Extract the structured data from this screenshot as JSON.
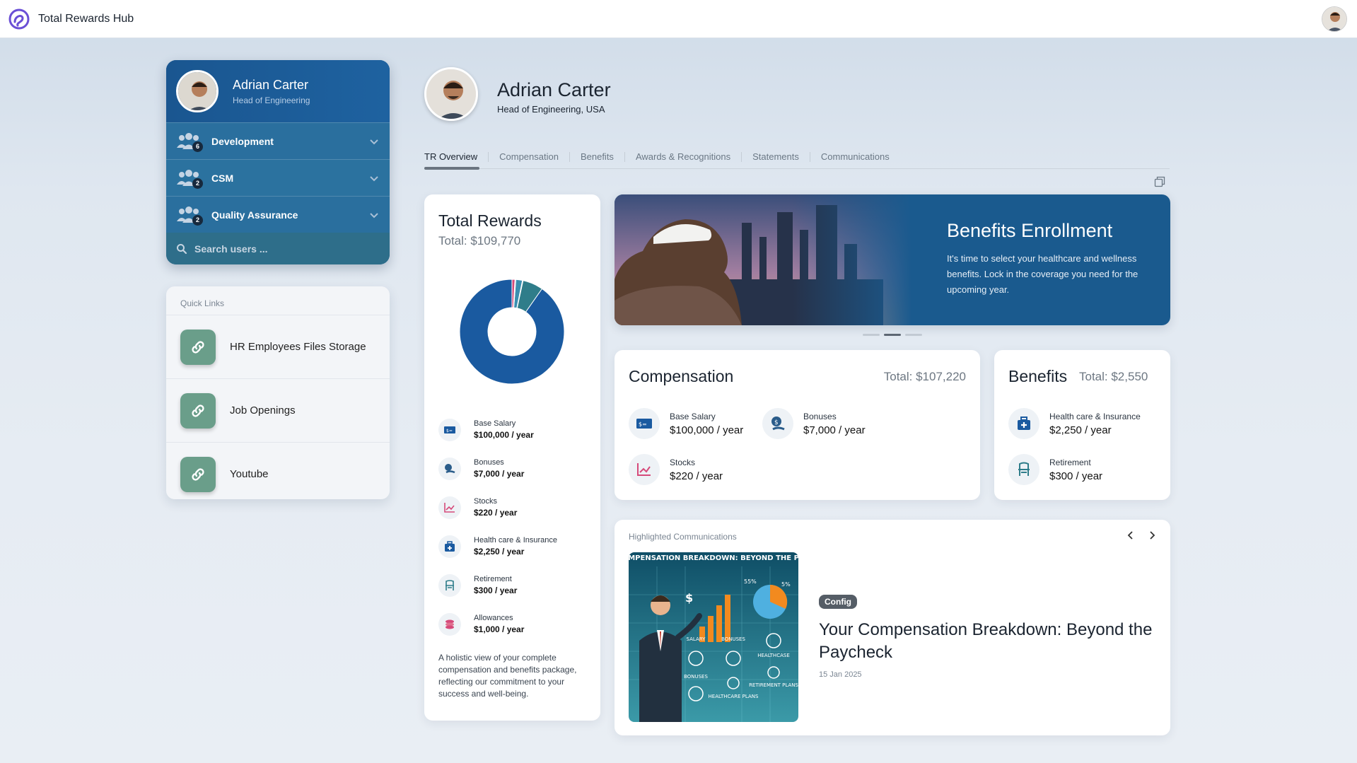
{
  "app": {
    "title": "Total Rewards Hub"
  },
  "sidebar": {
    "user": {
      "name": "Adrian Carter",
      "role": "Head of Engineering"
    },
    "groups": [
      {
        "label": "Development",
        "count": "6"
      },
      {
        "label": "CSM",
        "count": "2"
      },
      {
        "label": "Quality Assurance",
        "count": "2"
      }
    ],
    "search": {
      "placeholder": "Search users ..."
    }
  },
  "quick_links": {
    "title": "Quick Links",
    "items": [
      {
        "label": "HR Employees Files Storage"
      },
      {
        "label": "Job Openings"
      },
      {
        "label": "Youtube"
      }
    ]
  },
  "profile": {
    "name": "Adrian Carter",
    "role": "Head of Engineering, USA"
  },
  "tabs": [
    "TR Overview",
    "Compensation",
    "Benefits",
    "Awards & Recognitions",
    "Statements",
    "Communications"
  ],
  "total_rewards": {
    "title": "Total Rewards",
    "total": "Total: $109,770",
    "items": [
      {
        "label": "Base Salary",
        "value": "$100,000 / year"
      },
      {
        "label": "Bonuses",
        "value": "$7,000 / year"
      },
      {
        "label": "Stocks",
        "value": "$220 / year"
      },
      {
        "label": "Health care & Insurance",
        "value": "$2,250 / year"
      },
      {
        "label": "Retirement",
        "value": "$300 / year"
      },
      {
        "label": "Allowances",
        "value": "$1,000 / year"
      }
    ],
    "description": "A holistic view of your complete compensation and benefits package, reflecting our commitment to your success and well-being.",
    "donut_values": [
      100000,
      7000,
      220,
      2250,
      300,
      1000
    ],
    "donut_colors": [
      "#1a5aa0",
      "#2f7d8a",
      "#cfe0ea",
      "#3a8fb0",
      "#8a5aa8",
      "#d64a7a"
    ]
  },
  "banner": {
    "title": "Benefits Enrollment",
    "text": "It's time to select your healthcare and wellness benefits. Lock in the coverage you need for the upcoming year."
  },
  "compensation": {
    "title": "Compensation",
    "total": "Total: $107,220",
    "items": [
      {
        "label": "Base Salary",
        "value": "$100,000 / year"
      },
      {
        "label": "Bonuses",
        "value": "$7,000 / year"
      },
      {
        "label": "Stocks",
        "value": "$220 / year"
      }
    ]
  },
  "benefits": {
    "title": "Benefits",
    "total": "Total: $2,550",
    "items": [
      {
        "label": "Health care & Insurance",
        "value": "$2,250 / year"
      },
      {
        "label": "Retirement",
        "value": "$300 / year"
      }
    ]
  },
  "communications": {
    "label": "Highlighted Communications",
    "image_caption": "YOUR COMPENSATION BREAKDOWN: BEYOND THE PAYCHECK",
    "image_labels": [
      "SALARY",
      "BONUSES",
      "HEALTHCASE",
      "BONUSES",
      "HEALTHCARE PLANS",
      "RETIREMENT PLANS",
      "55%",
      "5%"
    ],
    "tag": "Config",
    "title": "Your Compensation Breakdown: Beyond the Paycheck",
    "date": "15 Jan 2025"
  }
}
